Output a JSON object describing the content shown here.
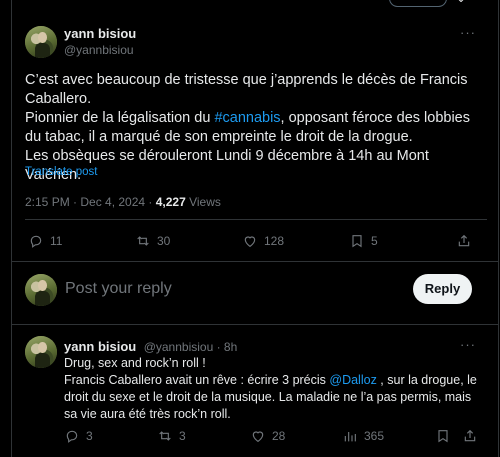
{
  "main_post": {
    "display_name": "yann bisiou",
    "handle": "@yannbisiou",
    "line1": "C’est avec beaucoup de tristesse que j’apprends le décès de Francis Caballero.",
    "line2_pre": "Pionnier de la légalisation du ",
    "hashtag": "#cannabis",
    "line2_post": ", opposant féroce des lobbies du tabac, il a marqué de son empreinte le droit de la drogue.",
    "line3": "Les obsèques se dérouleront Lundi 9 décembre à 14h au Mont Valérien.",
    "translate": "Translate post",
    "time": "2:15 PM · Dec 4, 2024 · ",
    "views_count": "4,227",
    "views_label": " Views",
    "replies": "11",
    "reposts": "30",
    "likes": "128",
    "bookmarks": "5"
  },
  "composer": {
    "placeholder": "Post your reply",
    "button": "Reply"
  },
  "reply_post": {
    "display_name": "yann bisiou",
    "handle_time": "@yannbisiou · 8h",
    "line1": "Drug, sex and rock’n roll !",
    "line2_pre": "Francis Caballero avait un rêve : écrire 3 précis ",
    "mention": "@Dalloz",
    "line2_post": " , sur la drogue, le droit du sexe et le droit de la musique. La maladie ne l’a pas permis, mais sa vie aura été très rock’n roll.",
    "replies": "3",
    "reposts": "3",
    "likes": "28",
    "views": "365"
  },
  "icons": [
    "more-icon",
    "reply-icon",
    "repost-icon",
    "like-icon",
    "bookmark-icon",
    "share-icon",
    "views-icon"
  ]
}
